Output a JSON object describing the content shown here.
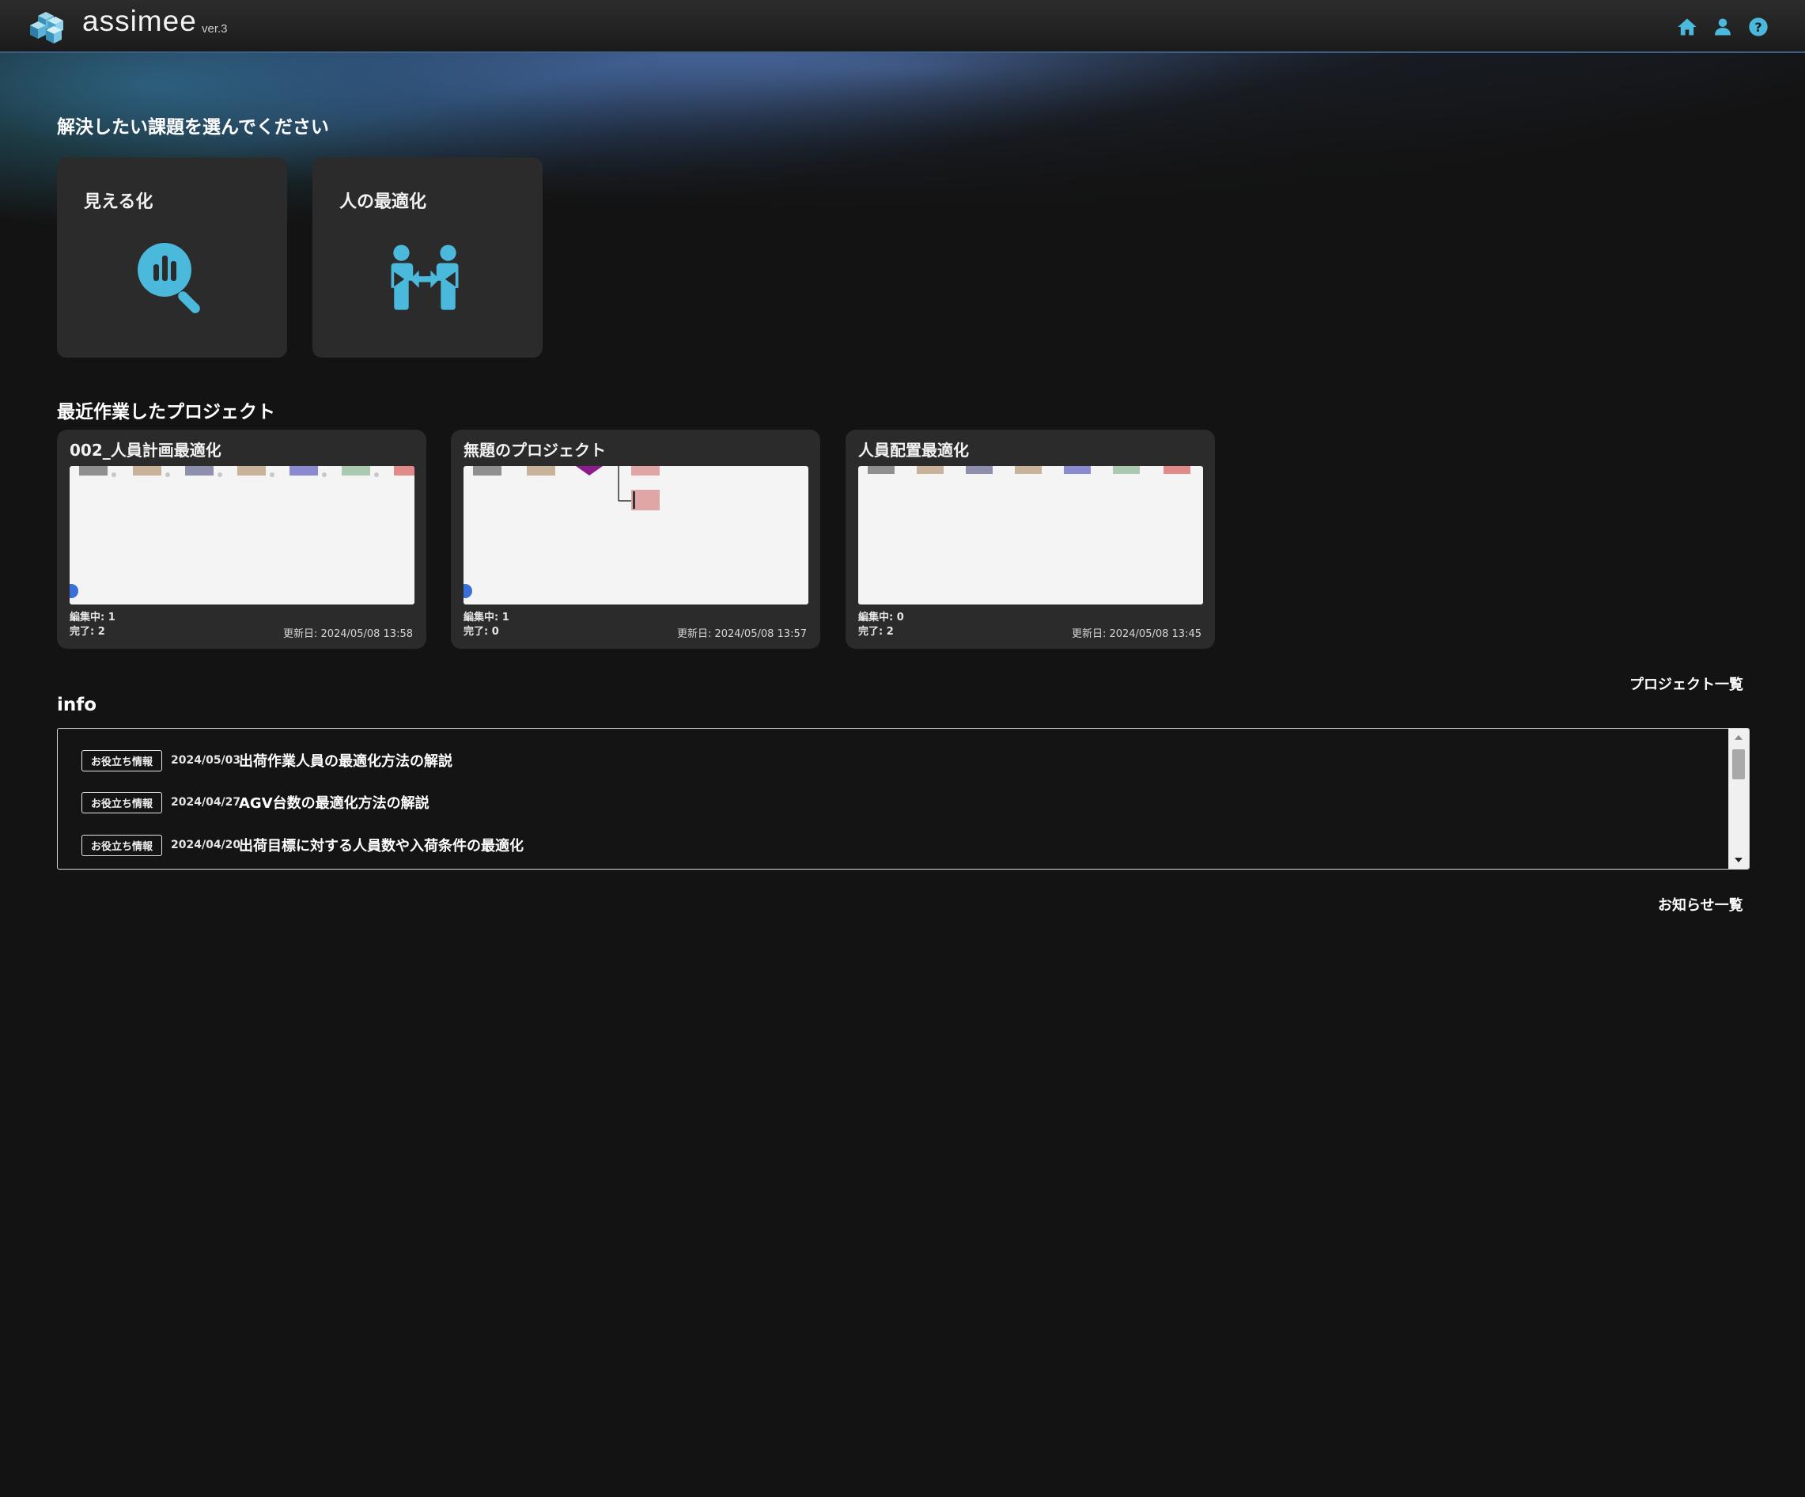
{
  "header": {
    "logo_text": "assimee",
    "version": "ver.3",
    "icons": [
      "home-icon",
      "user-icon",
      "help-icon"
    ],
    "accent_color": "#4ab9dc"
  },
  "tasks": {
    "heading": "解決したい課題を選んでください",
    "cards": [
      {
        "label": "見える化",
        "icon": "chart-search-icon"
      },
      {
        "label": "人の最適化",
        "icon": "people-exchange-icon"
      }
    ]
  },
  "recent": {
    "heading": "最近作業したプロジェクト",
    "projects": [
      {
        "name": "002_人員計画最適化",
        "editing": "編集中: 1",
        "done": "完了: 2",
        "updated": "更新日: 2024/05/08 13:58"
      },
      {
        "name": "無題のプロジェクト",
        "editing": "編集中: 1",
        "done": "完了: 0",
        "updated": "更新日: 2024/05/08 13:57"
      },
      {
        "name": "人員配置最適化",
        "editing": "編集中: 0",
        "done": "完了: 2",
        "updated": "更新日: 2024/05/08 13:45"
      }
    ],
    "all_link": "プロジェクト一覧"
  },
  "info": {
    "heading": "info",
    "items": [
      {
        "tag": "お役立ち情報",
        "date": "2024/05/03",
        "title": "出荷作業人員の最適化方法の解説"
      },
      {
        "tag": "お役立ち情報",
        "date": "2024/04/27",
        "title": "AGV台数の最適化方法の解説"
      },
      {
        "tag": "お役立ち情報",
        "date": "2024/04/20",
        "title": "出荷目標に対する人員数や入荷条件の最適化"
      }
    ],
    "all_link": "お知らせ一覧"
  }
}
